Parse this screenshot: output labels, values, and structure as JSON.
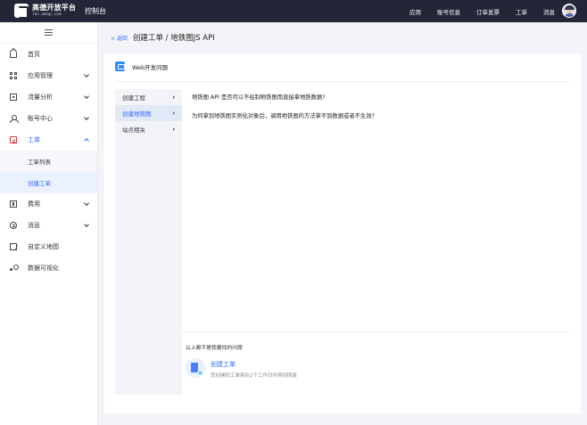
{
  "topbar": {
    "logo_title": "高德开放平台",
    "logo_sub": "lbs.amap.com",
    "console": "控制台",
    "nav": [
      "应用",
      "账号信息",
      "订单发票",
      "工单",
      "消息"
    ]
  },
  "sidebar": {
    "items": [
      {
        "label": "首页",
        "icon": "home-icon"
      },
      {
        "label": "应用管理",
        "icon": "apps-icon"
      },
      {
        "label": "流量分析",
        "icon": "analytics-icon"
      },
      {
        "label": "账号中心",
        "icon": "user-icon"
      },
      {
        "label": "工单",
        "icon": "ticket-icon"
      },
      {
        "label": "费用",
        "icon": "fee-icon"
      },
      {
        "label": "消息",
        "icon": "message-icon"
      },
      {
        "label": "自定义地图",
        "icon": "map-icon"
      },
      {
        "label": "数据可视化",
        "icon": "visualization-icon"
      }
    ],
    "sub_items": [
      "工单列表",
      "创建工单"
    ]
  },
  "breadcrumb": {
    "back": "< 返回",
    "title": "创建工单 / 地铁图JS API"
  },
  "card": {
    "title": "Web开发问题",
    "categories": [
      "创建工程",
      "创建地铁图",
      "站点相关"
    ],
    "questions": [
      "地铁图 API 是否可以不绘制地铁图而直接拿地铁数据?",
      "为何拿到地铁图实例化对象后，调用地铁图的方法拿不到数据或者不生效?"
    ],
    "footer_note": "以上都不是我要找的问题",
    "create_link": "创建工单",
    "create_desc": "您创建的工单将在2个工作日内得到回复"
  },
  "colors": {
    "topbar_bg": "#232636",
    "accent": "#2f6bff",
    "ticket_active": "#d9363e"
  }
}
